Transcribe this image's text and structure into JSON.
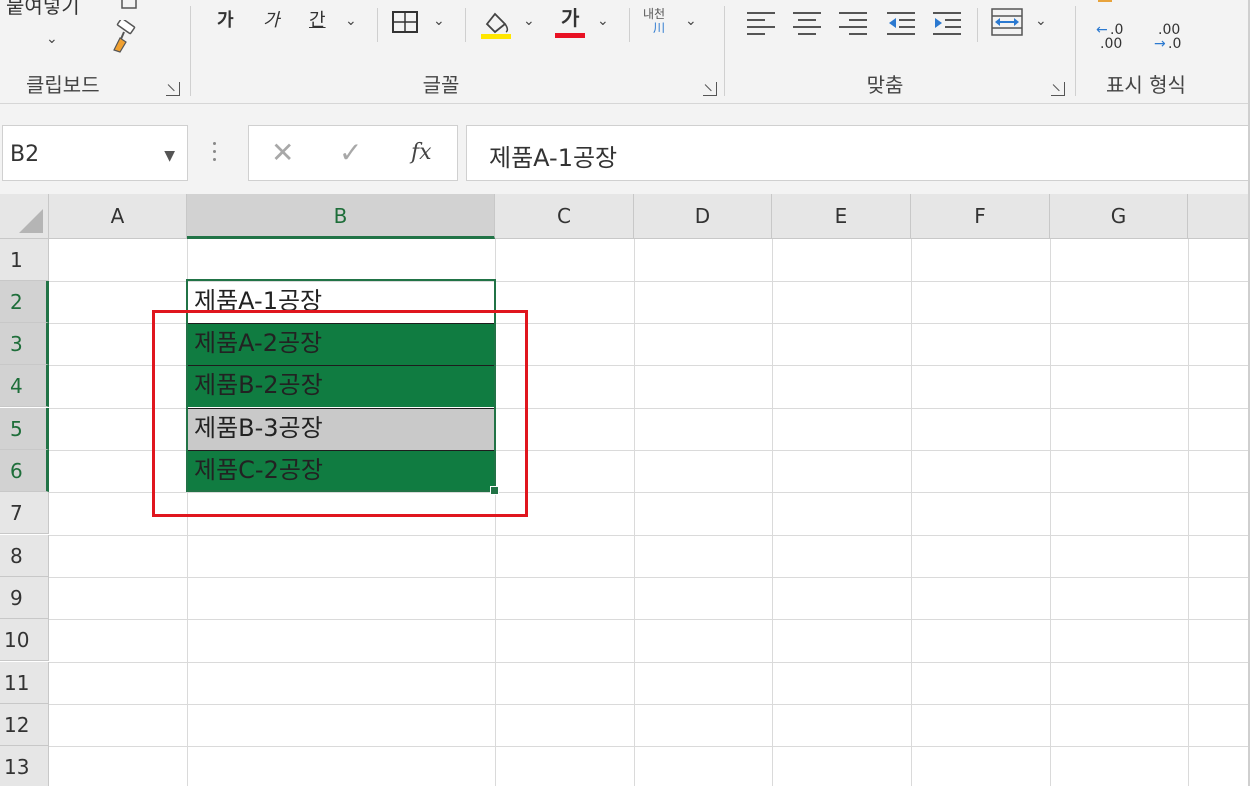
{
  "ribbon": {
    "clipboard": {
      "paste_label": "붙여넣기",
      "group_label": "클립보드"
    },
    "font": {
      "bold_glyph": "가",
      "italic_glyph": "가",
      "underline_glyph": "간",
      "font_color_glyph": "가",
      "phonetic_glyph": "내천",
      "phonetic_sub": "川",
      "group_label": "글꼴",
      "fill_color": "#ffe600",
      "font_color": "#e81123"
    },
    "alignment": {
      "group_label": "맞춤"
    },
    "number": {
      "group_label": "표시 형식",
      "inc_decimal_top": ".0",
      "inc_decimal_bottom": ".00",
      "dec_decimal_top": ".00",
      "dec_decimal_bottom": ".0"
    }
  },
  "formula_bar": {
    "name_box": "B2",
    "cancel_glyph": "✕",
    "enter_glyph": "✓",
    "fx_label": "fx",
    "value": "제품A-1공장"
  },
  "sheet": {
    "columns": [
      "A",
      "B",
      "C",
      "D",
      "E",
      "F",
      "G"
    ],
    "rows": [
      "1",
      "2",
      "3",
      "4",
      "5",
      "6",
      "7",
      "8",
      "9",
      "10",
      "11",
      "12",
      "13"
    ],
    "selected_column": "B",
    "cells": {
      "B2": "제품A-1공장",
      "B3": "제품A-2공장",
      "B4": "제품B-2공장",
      "B5": "제품B-3공장",
      "B6": "제품C-2공장"
    },
    "colors": {
      "highlight_green": "#107c41",
      "highlight_gray": "#c9c9c9",
      "selection": "#217346",
      "annotation_red": "#e0161e"
    }
  }
}
